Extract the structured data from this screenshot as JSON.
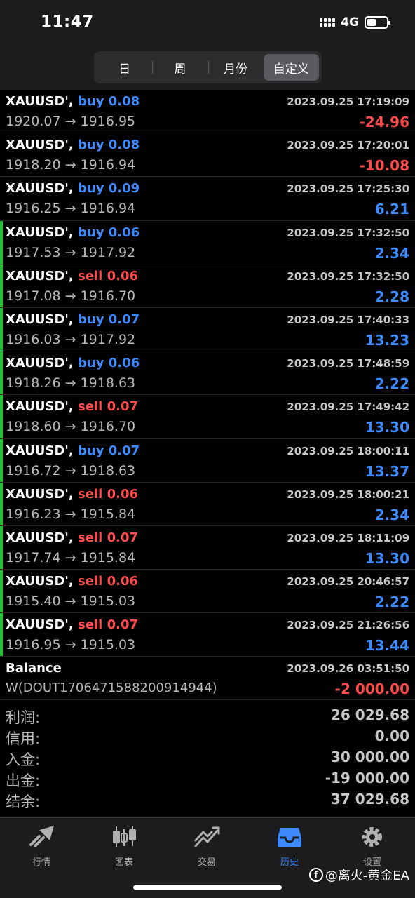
{
  "status": {
    "time": "11:47",
    "network": "4G"
  },
  "segment": {
    "tabs": [
      "日",
      "周",
      "月份",
      "自定义"
    ],
    "active_index": 3
  },
  "trades": [
    {
      "symbol": "XAUUSD',",
      "side": "buy",
      "volume": "0.08",
      "time": "2023.09.25 17:19:09",
      "open": "1920.07",
      "close": "1916.95",
      "profit": "-24.96",
      "sign": "neg",
      "marked": false
    },
    {
      "symbol": "XAUUSD',",
      "side": "buy",
      "volume": "0.08",
      "time": "2023.09.25 17:20:01",
      "open": "1918.20",
      "close": "1916.94",
      "profit": "-10.08",
      "sign": "neg",
      "marked": false
    },
    {
      "symbol": "XAUUSD',",
      "side": "buy",
      "volume": "0.09",
      "time": "2023.09.25 17:25:30",
      "open": "1916.25",
      "close": "1916.94",
      "profit": "6.21",
      "sign": "pos",
      "marked": false
    },
    {
      "symbol": "XAUUSD',",
      "side": "buy",
      "volume": "0.06",
      "time": "2023.09.25 17:32:50",
      "open": "1917.53",
      "close": "1917.92",
      "profit": "2.34",
      "sign": "pos",
      "marked": true
    },
    {
      "symbol": "XAUUSD',",
      "side": "sell",
      "volume": "0.06",
      "time": "2023.09.25 17:32:50",
      "open": "1917.08",
      "close": "1916.70",
      "profit": "2.28",
      "sign": "pos",
      "marked": true
    },
    {
      "symbol": "XAUUSD',",
      "side": "buy",
      "volume": "0.07",
      "time": "2023.09.25 17:40:33",
      "open": "1916.03",
      "close": "1917.92",
      "profit": "13.23",
      "sign": "pos",
      "marked": true
    },
    {
      "symbol": "XAUUSD',",
      "side": "buy",
      "volume": "0.06",
      "time": "2023.09.25 17:48:59",
      "open": "1918.26",
      "close": "1918.63",
      "profit": "2.22",
      "sign": "pos",
      "marked": true
    },
    {
      "symbol": "XAUUSD',",
      "side": "sell",
      "volume": "0.07",
      "time": "2023.09.25 17:49:42",
      "open": "1918.60",
      "close": "1916.70",
      "profit": "13.30",
      "sign": "pos",
      "marked": true
    },
    {
      "symbol": "XAUUSD',",
      "side": "buy",
      "volume": "0.07",
      "time": "2023.09.25 18:00:11",
      "open": "1916.72",
      "close": "1918.63",
      "profit": "13.37",
      "sign": "pos",
      "marked": true
    },
    {
      "symbol": "XAUUSD',",
      "side": "sell",
      "volume": "0.06",
      "time": "2023.09.25 18:00:21",
      "open": "1916.23",
      "close": "1915.84",
      "profit": "2.34",
      "sign": "pos",
      "marked": true
    },
    {
      "symbol": "XAUUSD',",
      "side": "sell",
      "volume": "0.07",
      "time": "2023.09.25 18:11:09",
      "open": "1917.74",
      "close": "1915.84",
      "profit": "13.30",
      "sign": "pos",
      "marked": true
    },
    {
      "symbol": "XAUUSD',",
      "side": "sell",
      "volume": "0.06",
      "time": "2023.09.25 20:46:57",
      "open": "1915.40",
      "close": "1915.03",
      "profit": "2.22",
      "sign": "pos",
      "marked": true
    },
    {
      "symbol": "XAUUSD',",
      "side": "sell",
      "volume": "0.07",
      "time": "2023.09.25 21:26:56",
      "open": "1916.95",
      "close": "1915.03",
      "profit": "13.44",
      "sign": "pos",
      "marked": true
    }
  ],
  "balance": {
    "label": "Balance",
    "time": "2023.09.26 03:51:50",
    "description": "W(DOUT1706471588200914944)",
    "amount": "-2 000.00"
  },
  "summary": [
    {
      "label": "利润:",
      "value": "26 029.68"
    },
    {
      "label": "信用:",
      "value": "0.00"
    },
    {
      "label": "入金:",
      "value": "30 000.00"
    },
    {
      "label": "出金:",
      "value": "-19 000.00"
    },
    {
      "label": "结余:",
      "value": "37 029.68"
    }
  ],
  "tabbar": [
    {
      "label": "行情",
      "icon": "quotes-icon"
    },
    {
      "label": "图表",
      "icon": "chart-icon"
    },
    {
      "label": "交易",
      "icon": "trade-icon"
    },
    {
      "label": "历史",
      "icon": "history-icon"
    },
    {
      "label": "设置",
      "icon": "settings-icon"
    }
  ],
  "tabbar_active_index": 3,
  "watermark": "@离火-黄金EA",
  "colors": {
    "buy": "#3d8bff",
    "sell": "#ff4b4b",
    "marker": "#23c035",
    "active_tab": "#3d8bff"
  }
}
